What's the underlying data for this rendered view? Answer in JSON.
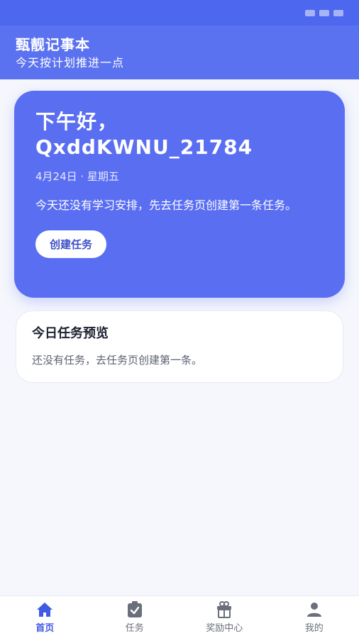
{
  "app": {
    "title": "甄靓记事本",
    "subtitle": "今天按计划推进一点"
  },
  "hero": {
    "greeting": "下午好，",
    "username": "QxddKWNU_21784",
    "date": "4月24日 · 星期五",
    "message": "今天还没有学习安排，先去任务页创建第一条任务。",
    "create_button": "创建任务"
  },
  "preview": {
    "title": "今日任务预览",
    "empty_text": "还没有任务，去任务页创建第一条。"
  },
  "tabs": [
    {
      "label": "首页",
      "icon": "home-icon",
      "active": true
    },
    {
      "label": "任务",
      "icon": "clipboard-check-icon",
      "active": false
    },
    {
      "label": "奖励中心",
      "icon": "gift-icon",
      "active": false
    },
    {
      "label": "我的",
      "icon": "person-icon",
      "active": false
    }
  ],
  "colors": {
    "primary": "#5a6ef2",
    "header": "#5b72f0",
    "active_tab": "#3f5ae3",
    "background": "#f5f7fd"
  }
}
